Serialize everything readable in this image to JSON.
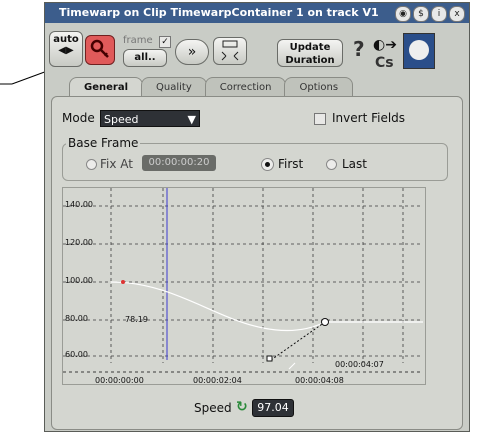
{
  "window": {
    "title": "Timewarp on Clip TimewarpContainer 1 on track V1"
  },
  "titlebar_icons": [
    "record-icon",
    "dollar-icon",
    "info-icon",
    "close-icon"
  ],
  "titlebar_glyphs": [
    "◉",
    "$",
    "i",
    "x"
  ],
  "toolbar": {
    "auto_label": "auto",
    "frame_label": "frame",
    "all_label": "all..",
    "update_duration_label": "Update\nDuration",
    "help_label": "?",
    "cs_label": "Cs"
  },
  "tabs": [
    {
      "label": "General",
      "active": true
    },
    {
      "label": "Quality",
      "active": false
    },
    {
      "label": "Correction",
      "active": false
    },
    {
      "label": "Options",
      "active": false
    }
  ],
  "general": {
    "mode_label": "Mode",
    "mode_value": "Speed",
    "invert_fields_label": "Invert Fields",
    "base_frame_label": "Base Frame",
    "fix_at_label": "Fix At",
    "fix_at_value": "00:00:00:20",
    "first_label": "First",
    "last_label": "Last",
    "selected_base": "First"
  },
  "chart_data": {
    "type": "line",
    "y_ticks": [
      "140.00",
      "120.00",
      "100.00",
      "80.00",
      "60.00"
    ],
    "x_ticks": [
      "00:00:00:00",
      "00:00:02:04",
      "00:00:04:08"
    ],
    "point_readout": "78.19",
    "keyframe_time_label": "00:00:04:07",
    "ylim": [
      50,
      150
    ],
    "colors": {
      "curve": "#ffffff",
      "playhead": "#3b3bd0",
      "grid": "#3a3a3a"
    }
  },
  "speed": {
    "label": "Speed",
    "value": "97.04"
  }
}
